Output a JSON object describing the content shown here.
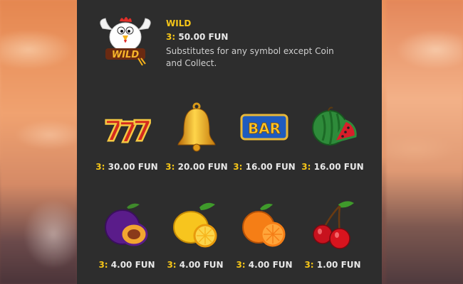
{
  "wild": {
    "title": "WILD",
    "pay_count": "3:",
    "pay_value": "50.00 FUN",
    "description": "Substitutes for any symbol except Coin and Collect.",
    "icon_text": "WILD",
    "icon": "rooster-wild-icon"
  },
  "symbols": [
    {
      "name": "seven",
      "count": "3:",
      "value": "30.00 FUN",
      "icon": "triple-seven-icon"
    },
    {
      "name": "bell",
      "count": "3:",
      "value": "20.00 FUN",
      "icon": "bell-icon"
    },
    {
      "name": "bar",
      "count": "3:",
      "value": "16.00 FUN",
      "icon": "bar-icon",
      "label": "BAR"
    },
    {
      "name": "watermelon",
      "count": "3:",
      "value": "16.00 FUN",
      "icon": "watermelon-icon"
    },
    {
      "name": "plum",
      "count": "3:",
      "value": "4.00 FUN",
      "icon": "plum-icon"
    },
    {
      "name": "lemon",
      "count": "3:",
      "value": "4.00 FUN",
      "icon": "lemon-icon"
    },
    {
      "name": "orange",
      "count": "3:",
      "value": "4.00 FUN",
      "icon": "orange-icon"
    },
    {
      "name": "cherry",
      "count": "3:",
      "value": "1.00 FUN",
      "icon": "cherry-icon"
    }
  ],
  "colors": {
    "panel": "#2d2d2d",
    "accent": "#f5c518",
    "text": "#e8e8e8"
  }
}
